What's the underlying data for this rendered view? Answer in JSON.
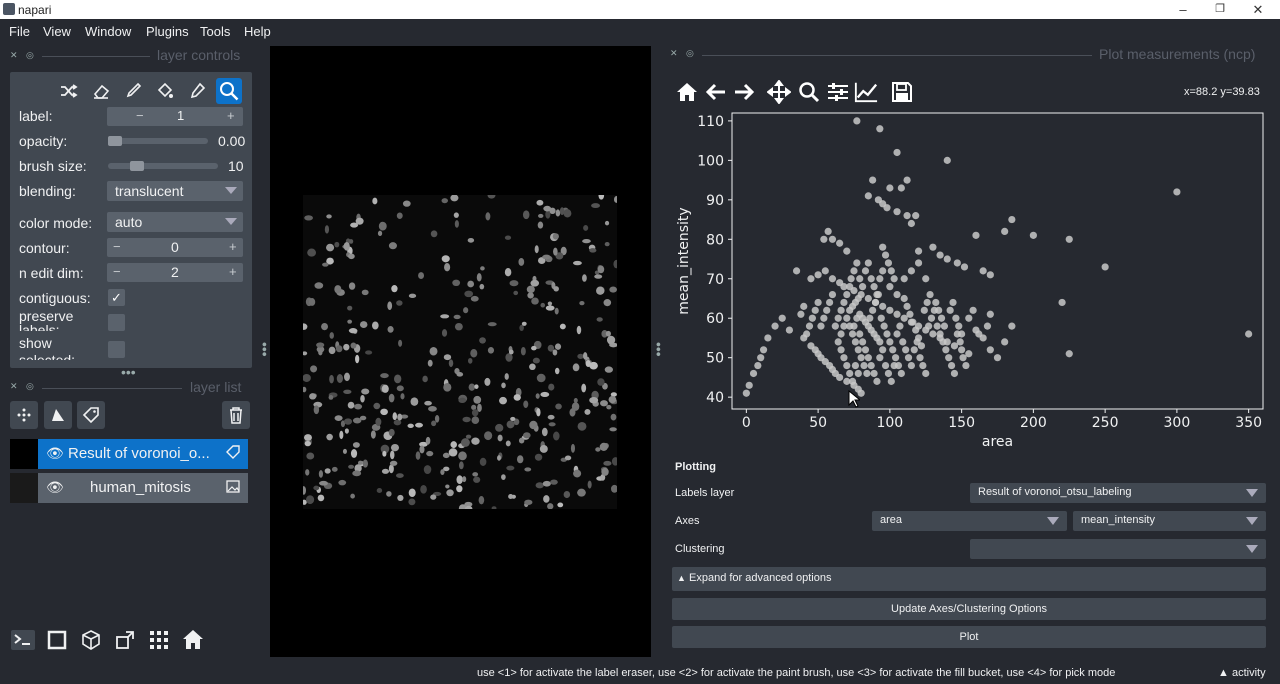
{
  "window": {
    "title": "napari",
    "minimize": "–",
    "restore": "❐",
    "close": "✕"
  },
  "menu": [
    "File",
    "View",
    "Window",
    "Plugins",
    "Tools",
    "Help"
  ],
  "layer_controls": {
    "header": "layer controls",
    "rows": {
      "label": {
        "label": "label:",
        "value": "1"
      },
      "opacity": {
        "label": "opacity:",
        "value": "0.00",
        "fraction": 0.0
      },
      "brush_size": {
        "label": "brush size:",
        "value": "10",
        "fraction": 0.08
      },
      "blending": {
        "label": "blending:",
        "value": "translucent"
      },
      "color_mode": {
        "label": "color mode:",
        "value": "auto"
      },
      "contour": {
        "label": "contour:",
        "value": "0"
      },
      "n_edit_dim": {
        "label": "n edit dim:",
        "value": "2"
      },
      "contiguous": {
        "label": "contiguous:",
        "checked": true
      },
      "preserve_labels": {
        "label": "preserve labels:",
        "checked": false
      },
      "show_selected": {
        "label": "show selected:",
        "checked": false
      }
    },
    "minus": "−",
    "plus": "+"
  },
  "layer_list": {
    "header": "layer list",
    "layers": [
      {
        "name": "Result of voronoi_o...",
        "selected": true,
        "visible": true,
        "type": "labels"
      },
      {
        "name": "human_mitosis",
        "selected": false,
        "visible": true,
        "type": "image"
      }
    ]
  },
  "plot": {
    "header": "Plot measurements (ncp)",
    "coords": "x=88.2 y=39.83"
  },
  "chart_data": {
    "type": "scatter",
    "xlabel": "area",
    "ylabel": "mean_intensity",
    "xlim": [
      -10,
      360
    ],
    "ylim": [
      37,
      112
    ],
    "xticks": [
      "0",
      "50",
      "100",
      "150",
      "200",
      "250",
      "300",
      "350"
    ],
    "xtick_values": [
      0,
      50,
      100,
      150,
      200,
      250,
      300,
      350
    ],
    "yticks": [
      "40",
      "50",
      "60",
      "70",
      "80",
      "90",
      "100",
      "110"
    ],
    "ytick_values": [
      40,
      50,
      60,
      70,
      80,
      90,
      100,
      110
    ],
    "color": "#c8c8c8",
    "points": [
      [
        77,
        110
      ],
      [
        93,
        108
      ],
      [
        105,
        102
      ],
      [
        140,
        100
      ],
      [
        100,
        93
      ],
      [
        108,
        93
      ],
      [
        112,
        95
      ],
      [
        88,
        95
      ],
      [
        85,
        91
      ],
      [
        92,
        90
      ],
      [
        95,
        89
      ],
      [
        98,
        88
      ],
      [
        105,
        87
      ],
      [
        112,
        86
      ],
      [
        118,
        86
      ],
      [
        115,
        84
      ],
      [
        300,
        92
      ],
      [
        185,
        85
      ],
      [
        180,
        82
      ],
      [
        200,
        81
      ],
      [
        225,
        80
      ],
      [
        160,
        81
      ],
      [
        57,
        82
      ],
      [
        60,
        80
      ],
      [
        54,
        80
      ],
      [
        65,
        79
      ],
      [
        70,
        77
      ],
      [
        95,
        78
      ],
      [
        120,
        77
      ],
      [
        130,
        78
      ],
      [
        135,
        76
      ],
      [
        140,
        75
      ],
      [
        147,
        74
      ],
      [
        152,
        73
      ],
      [
        165,
        72
      ],
      [
        170,
        71
      ],
      [
        250,
        73
      ],
      [
        35,
        72
      ],
      [
        45,
        70
      ],
      [
        50,
        71
      ],
      [
        55,
        72
      ],
      [
        60,
        70
      ],
      [
        65,
        69
      ],
      [
        68,
        68
      ],
      [
        72,
        68
      ],
      [
        75,
        67
      ],
      [
        80,
        66
      ],
      [
        85,
        65
      ],
      [
        90,
        64
      ],
      [
        95,
        63
      ],
      [
        100,
        62
      ],
      [
        105,
        61
      ],
      [
        110,
        60
      ],
      [
        115,
        59
      ],
      [
        120,
        58
      ],
      [
        125,
        57
      ],
      [
        130,
        56
      ],
      [
        135,
        55
      ],
      [
        140,
        54
      ],
      [
        145,
        53
      ],
      [
        150,
        52
      ],
      [
        155,
        51
      ],
      [
        160,
        57
      ],
      [
        168,
        58
      ],
      [
        170,
        61
      ],
      [
        220,
        64
      ],
      [
        225,
        51
      ],
      [
        350,
        56
      ],
      [
        20,
        58
      ],
      [
        25,
        60
      ],
      [
        15,
        55
      ],
      [
        10,
        50
      ],
      [
        8,
        48
      ],
      [
        5,
        46
      ],
      [
        0,
        41
      ],
      [
        2,
        43
      ],
      [
        12,
        52
      ],
      [
        30,
        57
      ],
      [
        40,
        55
      ],
      [
        45,
        53
      ],
      [
        48,
        52
      ],
      [
        50,
        51
      ],
      [
        52,
        50
      ],
      [
        55,
        49
      ],
      [
        58,
        48
      ],
      [
        60,
        47
      ],
      [
        62,
        46
      ],
      [
        65,
        45
      ],
      [
        70,
        44
      ],
      [
        75,
        43
      ],
      [
        78,
        42
      ],
      [
        80,
        41
      ],
      [
        72,
        62
      ],
      [
        74,
        63
      ],
      [
        76,
        64
      ],
      [
        78,
        65
      ],
      [
        79,
        61
      ],
      [
        81,
        60
      ],
      [
        83,
        59
      ],
      [
        85,
        58
      ],
      [
        87,
        57
      ],
      [
        89,
        56
      ],
      [
        91,
        55
      ],
      [
        93,
        54
      ],
      [
        70,
        60
      ],
      [
        68,
        58
      ],
      [
        66,
        56
      ],
      [
        64,
        54
      ],
      [
        62,
        58
      ],
      [
        64,
        60
      ],
      [
        66,
        62
      ],
      [
        68,
        64
      ],
      [
        70,
        66
      ],
      [
        72,
        58
      ],
      [
        74,
        56
      ],
      [
        76,
        54
      ],
      [
        78,
        52
      ],
      [
        80,
        50
      ],
      [
        82,
        48
      ],
      [
        84,
        46
      ],
      [
        86,
        60
      ],
      [
        88,
        62
      ],
      [
        90,
        64
      ],
      [
        92,
        66
      ],
      [
        94,
        60
      ],
      [
        96,
        58
      ],
      [
        98,
        56
      ],
      [
        100,
        54
      ],
      [
        102,
        52
      ],
      [
        104,
        50
      ],
      [
        106,
        48
      ],
      [
        108,
        46
      ],
      [
        110,
        65
      ],
      [
        112,
        63
      ],
      [
        114,
        61
      ],
      [
        116,
        59
      ],
      [
        118,
        57
      ],
      [
        120,
        55
      ],
      [
        122,
        53
      ],
      [
        124,
        62
      ],
      [
        126,
        64
      ],
      [
        128,
        66
      ],
      [
        132,
        64
      ],
      [
        134,
        62
      ],
      [
        136,
        60
      ],
      [
        138,
        58
      ],
      [
        142,
        62
      ],
      [
        144,
        64
      ],
      [
        146,
        60
      ],
      [
        148,
        58
      ],
      [
        150,
        56
      ],
      [
        155,
        60
      ],
      [
        158,
        62
      ],
      [
        162,
        56
      ],
      [
        165,
        55
      ],
      [
        170,
        52
      ],
      [
        175,
        50
      ],
      [
        180,
        54
      ],
      [
        185,
        58
      ],
      [
        110,
        70
      ],
      [
        115,
        72
      ],
      [
        120,
        74
      ],
      [
        125,
        70
      ],
      [
        100,
        68
      ],
      [
        105,
        66
      ],
      [
        60,
        66
      ],
      [
        58,
        64
      ],
      [
        56,
        62
      ],
      [
        54,
        60
      ],
      [
        52,
        58
      ],
      [
        50,
        64
      ],
      [
        48,
        62
      ],
      [
        46,
        60
      ],
      [
        44,
        58
      ],
      [
        42,
        56
      ],
      [
        40,
        63
      ],
      [
        38,
        61
      ],
      [
        73,
        70
      ],
      [
        75,
        72
      ],
      [
        77,
        74
      ],
      [
        79,
        70
      ],
      [
        81,
        68
      ],
      [
        83,
        72
      ],
      [
        85,
        74
      ],
      [
        87,
        70
      ],
      [
        89,
        68
      ],
      [
        91,
        66
      ],
      [
        93,
        70
      ],
      [
        95,
        72
      ],
      [
        97,
        76
      ],
      [
        99,
        74
      ],
      [
        101,
        72
      ],
      [
        103,
        70
      ],
      [
        75,
        58
      ],
      [
        77,
        60
      ],
      [
        79,
        56
      ],
      [
        81,
        54
      ],
      [
        83,
        52
      ],
      [
        85,
        50
      ],
      [
        87,
        48
      ],
      [
        89,
        46
      ],
      [
        91,
        44
      ],
      [
        93,
        50
      ],
      [
        95,
        52
      ],
      [
        97,
        48
      ],
      [
        99,
        46
      ],
      [
        101,
        44
      ],
      [
        103,
        48
      ],
      [
        105,
        56
      ],
      [
        107,
        58
      ],
      [
        109,
        54
      ],
      [
        111,
        52
      ],
      [
        113,
        50
      ],
      [
        115,
        48
      ],
      [
        117,
        52
      ],
      [
        119,
        54
      ],
      [
        121,
        50
      ],
      [
        123,
        48
      ],
      [
        125,
        46
      ],
      [
        127,
        58
      ],
      [
        129,
        60
      ],
      [
        131,
        62
      ],
      [
        133,
        58
      ],
      [
        135,
        56
      ],
      [
        137,
        54
      ],
      [
        139,
        52
      ],
      [
        141,
        50
      ],
      [
        143,
        48
      ],
      [
        145,
        46
      ],
      [
        147,
        56
      ],
      [
        149,
        54
      ],
      [
        151,
        50
      ],
      [
        153,
        48
      ],
      [
        66,
        52
      ],
      [
        68,
        50
      ],
      [
        70,
        48
      ],
      [
        72,
        46
      ],
      [
        74,
        44
      ],
      [
        76,
        48
      ],
      [
        78,
        46
      ]
    ]
  },
  "plotting_form": {
    "title": "Plotting",
    "labels_layer": {
      "label": "Labels layer",
      "value": "Result of voronoi_otsu_labeling"
    },
    "axes": {
      "label": "Axes",
      "x": "area",
      "y": "mean_intensity"
    },
    "clustering": {
      "label": "Clustering",
      "value": ""
    },
    "expand": "Expand for advanced options",
    "update_btn": "Update Axes/Clustering Options",
    "plot_btn": "Plot"
  },
  "status": {
    "message": "use <1> for activate the label eraser, use <2> for activate the paint brush, use <3> for activate the fill bucket, use <4> for pick mode",
    "activity": "activity"
  }
}
